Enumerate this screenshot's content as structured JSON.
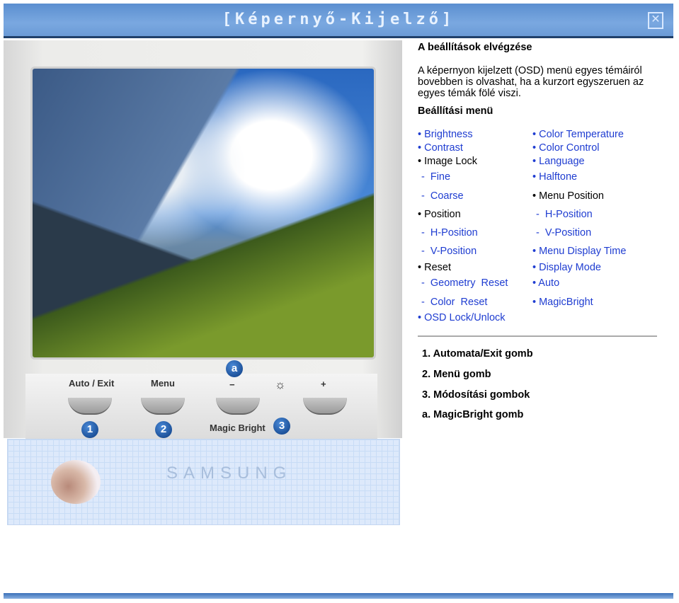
{
  "window": {
    "title": "[Képernyő-Kijelző]",
    "close_icon": "close-icon"
  },
  "monitor": {
    "buttons": [
      "Auto / Exit",
      "Menu",
      "−",
      "☼",
      "+"
    ],
    "magic_bright_label": "Magic Bright",
    "badges": [
      "1",
      "2",
      "3",
      "a"
    ],
    "brand": "SAMSUNG"
  },
  "content": {
    "heading": "A beállítások elvégzése",
    "intro_lines": [
      "A képernyon kijelzett (OSD) menü egyes témáiról",
      "bovebben is olvashat, ha a kurzort egyszeruen az",
      "egyes témák fölé viszi."
    ],
    "menu_heading": "Beállítási menü",
    "left_items": [
      {
        "text": "• Brightness",
        "link": true
      },
      {
        "text": "• Contrast",
        "link": true
      },
      {
        "text": "• Image Lock",
        "link": false
      },
      {
        "text": "- Fine",
        "link": true
      },
      {
        "text": "- Coarse",
        "link": true
      },
      {
        "text": "• Position",
        "link": false
      },
      {
        "text": "- H-Position",
        "link": true
      },
      {
        "text": "- V-Position",
        "link": true
      },
      {
        "text": "• Reset",
        "link": false
      },
      {
        "text": "- Geometry Reset",
        "link": true
      },
      {
        "text": "- Color Reset",
        "link": true
      },
      {
        "text": "• OSD Lock/Unlock",
        "link": true
      }
    ],
    "right_items": [
      {
        "text": "• Color Temperature",
        "link": true
      },
      {
        "text": "• Color Control",
        "link": true
      },
      {
        "text": "• Language",
        "link": true
      },
      {
        "text": "• Halftone",
        "link": true
      },
      {
        "text": "• Menu Position",
        "link": false
      },
      {
        "text": "- H-Position",
        "link": true
      },
      {
        "text": "- V-Position",
        "link": true
      },
      {
        "text": "• Menu Display Time",
        "link": true
      },
      {
        "text": "• Display Mode",
        "link": true
      },
      {
        "text": "• Auto",
        "link": true
      },
      {
        "text": "• MagicBright",
        "link": true
      }
    ],
    "legend": [
      "1.  Automata/Exit gomb",
      "2.  Menü gomb",
      "3.  Módosítási gombok",
      "a.  MagicBright gomb"
    ]
  },
  "colors": {
    "link": "#1f3dd1",
    "titlebar": "#6a9ad6"
  }
}
